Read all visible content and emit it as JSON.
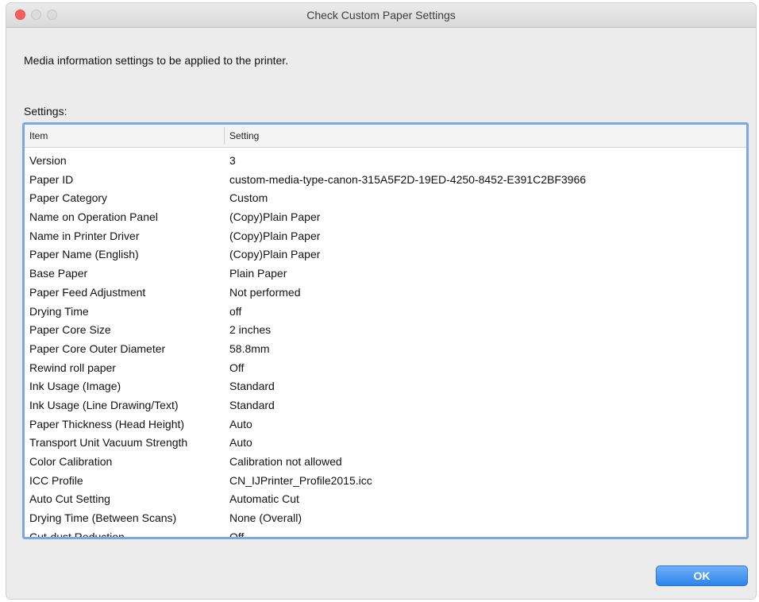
{
  "window": {
    "title": "Check Custom Paper Settings"
  },
  "description": "Media information settings to be applied to the printer.",
  "settings_label": "Settings:",
  "table": {
    "columns": [
      "Item",
      "Setting"
    ],
    "rows": [
      {
        "item": "Version",
        "setting": "3"
      },
      {
        "item": "Paper ID",
        "setting": "custom-media-type-canon-315A5F2D-19ED-4250-8452-E391C2BF3966"
      },
      {
        "item": "Paper Category",
        "setting": "Custom"
      },
      {
        "item": "Name on Operation Panel",
        "setting": "(Copy)Plain Paper"
      },
      {
        "item": "Name in Printer Driver",
        "setting": "(Copy)Plain Paper"
      },
      {
        "item": "Paper Name (English)",
        "setting": "(Copy)Plain Paper"
      },
      {
        "item": "Base Paper",
        "setting": "Plain Paper"
      },
      {
        "item": "Paper Feed Adjustment",
        "setting": "Not performed"
      },
      {
        "item": "Drying Time",
        "setting": "off"
      },
      {
        "item": "Paper Core Size",
        "setting": "2 inches"
      },
      {
        "item": "Paper Core Outer Diameter",
        "setting": "58.8mm"
      },
      {
        "item": "Rewind roll paper",
        "setting": "Off"
      },
      {
        "item": "Ink Usage (Image)",
        "setting": "Standard"
      },
      {
        "item": "Ink Usage (Line Drawing/Text)",
        "setting": "Standard"
      },
      {
        "item": "Paper Thickness (Head Height)",
        "setting": "Auto"
      },
      {
        "item": "Transport Unit Vacuum Strength",
        "setting": "Auto"
      },
      {
        "item": "Color Calibration",
        "setting": "Calibration not allowed"
      },
      {
        "item": "ICC Profile",
        "setting": "CN_IJPrinter_Profile2015.icc"
      },
      {
        "item": "Auto Cut Setting",
        "setting": "Automatic Cut"
      },
      {
        "item": "Drying Time (Between Scans)",
        "setting": "None (Overall)"
      },
      {
        "item": "Cut-dust Reduction",
        "setting": "Off"
      }
    ]
  },
  "buttons": {
    "ok_label": "OK"
  },
  "colors": {
    "close_button": "#fc5f57",
    "focus_ring": "#7ba7e6",
    "ok_button": "#2d84ec"
  }
}
